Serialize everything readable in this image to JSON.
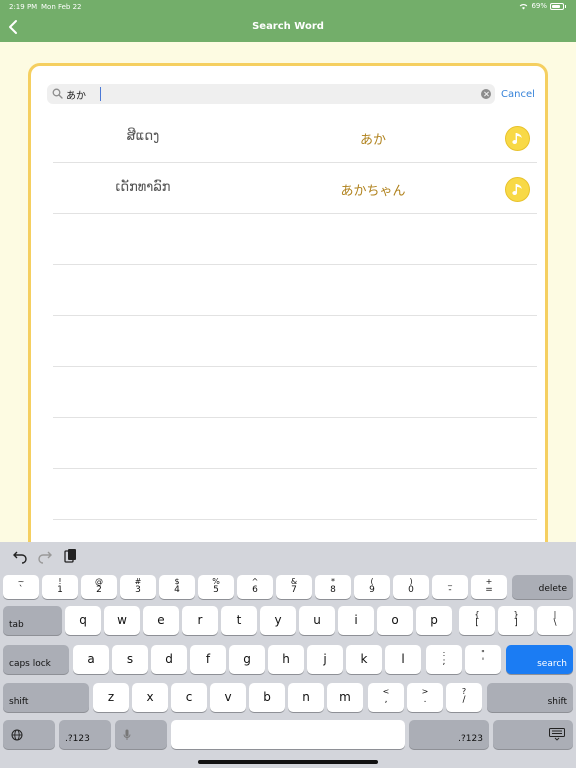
{
  "status": {
    "time": "2:19 PM",
    "date": "Mon Feb 22",
    "battery": "69%"
  },
  "nav": {
    "title": "Search Word"
  },
  "search": {
    "value": "あか",
    "cancel": "Cancel"
  },
  "results": [
    {
      "lao": "ສີແດງ",
      "jp": "あか"
    },
    {
      "lao": "ເດັກທາລົກ",
      "jp": "あかちゃん"
    }
  ],
  "keyboard": {
    "num_row": [
      {
        "s": "~",
        "m": "`"
      },
      {
        "s": "!",
        "m": "1"
      },
      {
        "s": "@",
        "m": "2"
      },
      {
        "s": "#",
        "m": "3"
      },
      {
        "s": "$",
        "m": "4"
      },
      {
        "s": "%",
        "m": "5"
      },
      {
        "s": "^",
        "m": "6"
      },
      {
        "s": "&",
        "m": "7"
      },
      {
        "s": "*",
        "m": "8"
      },
      {
        "s": "(",
        "m": "9"
      },
      {
        "s": ")",
        "m": "0"
      },
      {
        "s": "_",
        "m": "-"
      },
      {
        "s": "+",
        "m": "="
      }
    ],
    "delete": "delete",
    "tab": "tab",
    "row1": [
      "q",
      "w",
      "e",
      "r",
      "t",
      "y",
      "u",
      "i",
      "o",
      "p"
    ],
    "row1_extra": [
      {
        "s": "{",
        "m": "["
      },
      {
        "s": "}",
        "m": "]"
      },
      {
        "s": "|",
        "m": "\\"
      }
    ],
    "caps": "caps lock",
    "row2": [
      "a",
      "s",
      "d",
      "f",
      "g",
      "h",
      "j",
      "k",
      "l"
    ],
    "row2_extra": [
      {
        "s": ":",
        "m": ";"
      },
      {
        "s": "\"",
        "m": "'"
      }
    ],
    "search": "search",
    "shift": "shift",
    "row3": [
      "z",
      "x",
      "c",
      "v",
      "b",
      "n",
      "m"
    ],
    "row3_extra": [
      {
        "s": "<",
        "m": ","
      },
      {
        "s": ">",
        "m": "."
      },
      {
        "s": "?",
        "m": "/"
      }
    ],
    "numbers": ".?123"
  },
  "colors": {
    "nav": "#73ae6a",
    "card_border": "#f5cf60",
    "accent": "#3783d9",
    "jp_text": "#b0821d"
  }
}
